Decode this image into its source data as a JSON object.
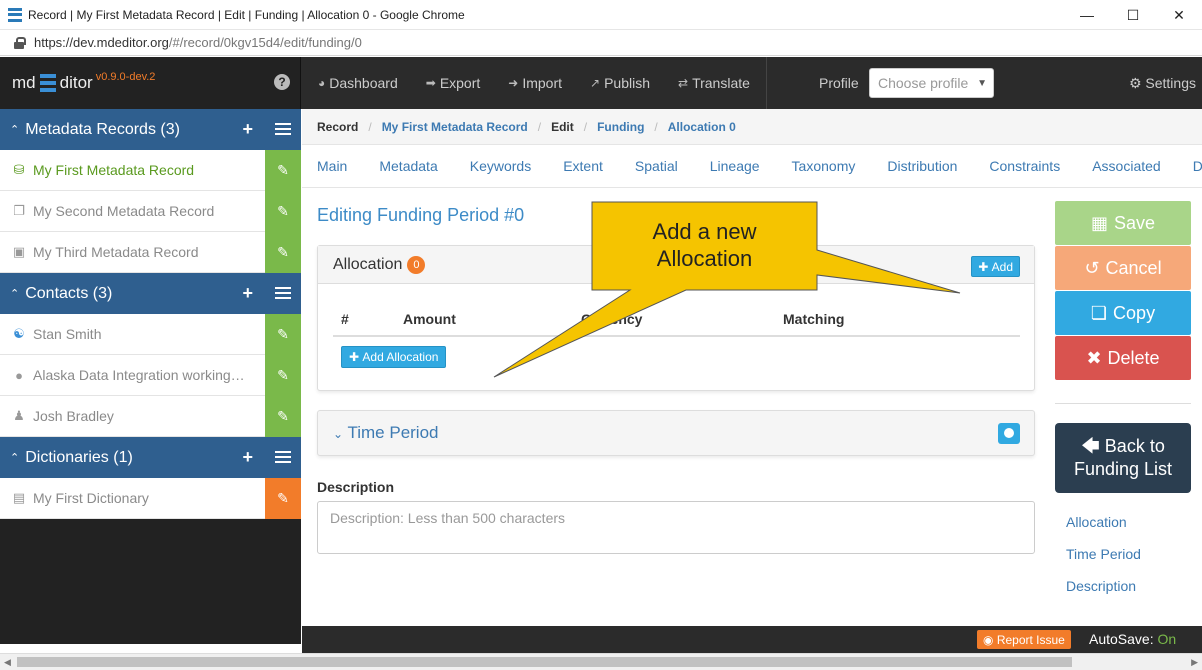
{
  "window": {
    "title": "Record | My First Metadata Record | Edit | Funding | Allocation 0 - Google Chrome",
    "url_host": "https://dev.mdeditor.org",
    "url_path": "/#/record/0kgv15d4/edit/funding/0"
  },
  "brand": {
    "md": "md",
    "ditor": "ditor",
    "version": "v0.9.0-dev.2"
  },
  "topnav": {
    "items": [
      {
        "label": "Dashboard",
        "icon": "dashboard-icon"
      },
      {
        "label": "Export",
        "icon": "export-icon"
      },
      {
        "label": "Import",
        "icon": "import-icon"
      },
      {
        "label": "Publish",
        "icon": "publish-icon"
      },
      {
        "label": "Translate",
        "icon": "translate-icon"
      }
    ],
    "profile_label": "Profile",
    "profile_placeholder": "Choose profile",
    "settings": "Settings"
  },
  "sidebar": {
    "sections": [
      {
        "title": "Metadata Records (3)",
        "items": [
          {
            "label": "My First Metadata Record",
            "icon": "database-icon",
            "active": true
          },
          {
            "label": "My Second Metadata Record",
            "icon": "copy-doc-icon"
          },
          {
            "label": "My Third Metadata Record",
            "icon": "image-icon"
          }
        ]
      },
      {
        "title": "Contacts (3)",
        "items": [
          {
            "label": "Stan Smith",
            "icon": "person-icon"
          },
          {
            "label": "Alaska Data Integration working group",
            "icon": "group-icon"
          },
          {
            "label": "Josh Bradley",
            "icon": "user-icon"
          }
        ]
      },
      {
        "title": "Dictionaries (1)",
        "items": [
          {
            "label": "My First Dictionary",
            "icon": "book-icon"
          }
        ]
      }
    ]
  },
  "breadcrumb": [
    "Record",
    "My First Metadata Record",
    "Edit",
    "Funding",
    "Allocation 0"
  ],
  "tabs": [
    "Main",
    "Metadata",
    "Keywords",
    "Extent",
    "Spatial",
    "Lineage",
    "Taxonomy",
    "Distribution",
    "Constraints",
    "Associated",
    "Documents"
  ],
  "page_title": "Editing Funding Period #0",
  "allocation": {
    "title": "Allocation",
    "count": "0",
    "add_label": "Add",
    "columns": [
      "#",
      "Amount",
      "Currency",
      "Matching"
    ],
    "add_allocation_label": "Add Allocation"
  },
  "time_period": {
    "title": "Time Period"
  },
  "description": {
    "label": "Description",
    "placeholder": "Description: Less than 500 characters"
  },
  "actions": {
    "save": "Save",
    "cancel": "Cancel",
    "copy": "Copy",
    "delete": "Delete",
    "back_line1": "Back to",
    "back_line2": "Funding List"
  },
  "side_links": [
    "Allocation",
    "Time Period",
    "Description"
  ],
  "footer": {
    "report": "Report Issue",
    "autosave_label": "AutoSave:",
    "autosave_value": "On"
  },
  "callout": {
    "line1": "Add a new",
    "line2": "Allocation"
  },
  "colors": {
    "accent": "#31a9e1",
    "sidebar_head": "#2f5f8f",
    "callout_fill": "#f5c400"
  }
}
